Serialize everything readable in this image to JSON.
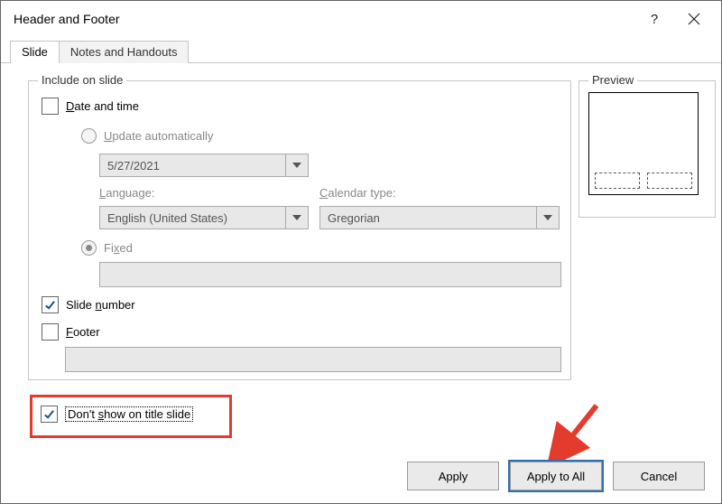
{
  "title": "Header and Footer",
  "tabs": {
    "slide": "Slide",
    "notes": "Notes and Handouts"
  },
  "groups": {
    "include": "Include on slide",
    "preview": "Preview"
  },
  "datetime": {
    "label": "Date and time",
    "mn": "D"
  },
  "update_auto": {
    "label": "Update automatically",
    "mn": "U"
  },
  "date_value": "5/27/2021",
  "language": {
    "label": "Language:",
    "mn": "L",
    "value": "English (United States)"
  },
  "calendar": {
    "label": "Calendar type:",
    "mn": "C",
    "value": "Gregorian"
  },
  "fixed": {
    "label": "Fixed",
    "mn": "x"
  },
  "slide_number": {
    "label": "Slide number",
    "mn": "n"
  },
  "footer": {
    "label": "Footer",
    "mn": "F"
  },
  "dont_show": {
    "label": "Don't show on title slide",
    "mn": "s"
  },
  "buttons": {
    "apply": "Apply",
    "apply_all": "Apply to All",
    "cancel": "Cancel"
  }
}
